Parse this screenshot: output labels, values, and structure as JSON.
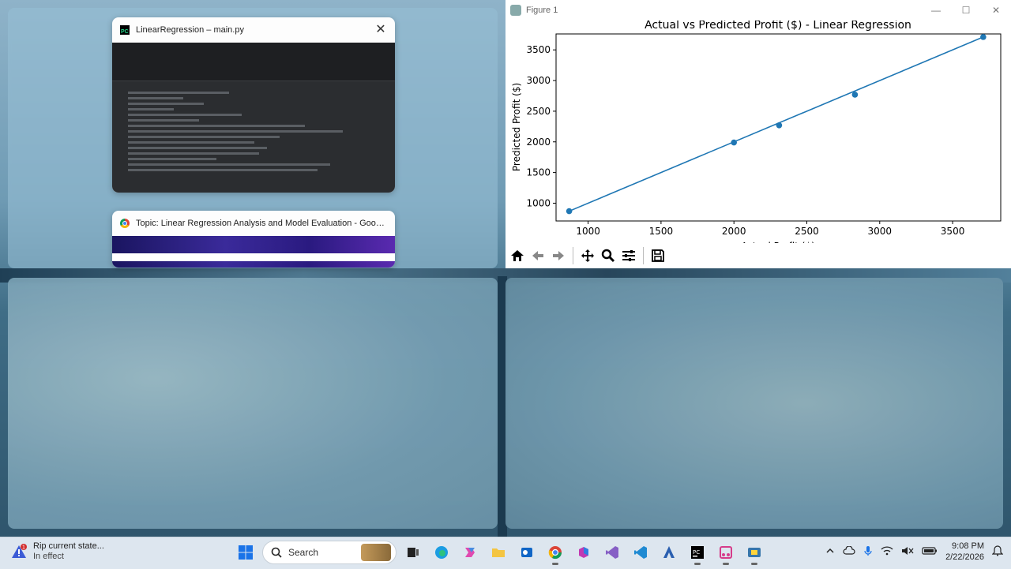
{
  "snap_windows": {
    "pycharm": {
      "title": "LinearRegression – main.py"
    },
    "chrome": {
      "title": "Topic: Linear Regression Analysis and Model Evaluation - Google Chr..."
    }
  },
  "figure": {
    "window_title": "Figure 1",
    "chart_data": {
      "type": "scatter",
      "title": "Actual vs Predicted Profit ($) - Linear Regression",
      "ylabel": "Predicted Profit ($)",
      "xlabel": "Actual Profit ($)",
      "xlim": [
        780,
        3830
      ],
      "ylim": [
        710,
        3760
      ],
      "xticks": [
        1000,
        1500,
        2000,
        2500,
        3000,
        3500
      ],
      "yticks": [
        1000,
        1500,
        2000,
        2500,
        3000,
        3500
      ],
      "points": [
        {
          "x": 870,
          "y": 870
        },
        {
          "x": 2000,
          "y": 1990
        },
        {
          "x": 2310,
          "y": 2270
        },
        {
          "x": 2830,
          "y": 2770
        },
        {
          "x": 3710,
          "y": 3710
        }
      ],
      "fit_line": {
        "x": [
          870,
          3710
        ],
        "y": [
          870,
          3710
        ]
      },
      "color": "#1f77b4",
      "grid": false
    }
  },
  "taskbar": {
    "notification": {
      "title": "Rip current state...",
      "subtitle": "In effect",
      "badge": "1"
    },
    "search_label": "Search",
    "time": "9:08 PM",
    "date": "2/22/2026"
  }
}
